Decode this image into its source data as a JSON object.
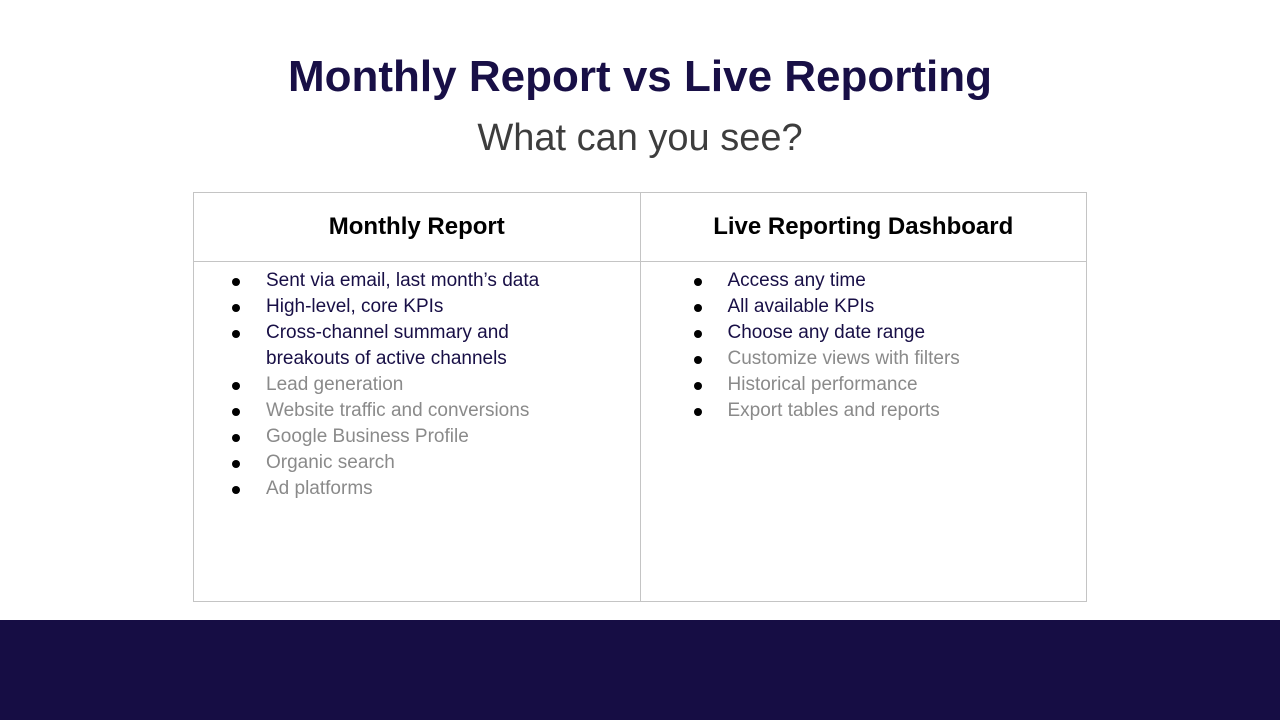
{
  "header": {
    "title": "Monthly Report vs Live Reporting",
    "subtitle": "What can you see?"
  },
  "colors": {
    "title": "#180f46",
    "subtitle": "#3d3d3d",
    "text_primary": "#180f46",
    "text_muted": "#8a8a8a",
    "footer": "#160d44",
    "border": "#c4c4c4"
  },
  "table": {
    "columns": [
      {
        "heading": "Monthly Report",
        "items": [
          {
            "text": "Sent via email, last month’s data",
            "style": "dark"
          },
          {
            "text": "High-level, core KPIs",
            "style": "dark"
          },
          {
            "text": "Cross-channel summary and breakouts of active channels",
            "style": "dark"
          },
          {
            "text": "Lead generation",
            "style": "muted"
          },
          {
            "text": "Website traffic and conversions",
            "style": "muted"
          },
          {
            "text": "Google Business Profile",
            "style": "muted"
          },
          {
            "text": "Organic search",
            "style": "muted"
          },
          {
            "text": "Ad platforms",
            "style": "muted"
          }
        ]
      },
      {
        "heading": "Live Reporting Dashboard",
        "items": [
          {
            "text": "Access any time",
            "style": "dark"
          },
          {
            "text": "All available KPIs",
            "style": "dark"
          },
          {
            "text": "Choose any date range",
            "style": "dark"
          },
          {
            "text": "Customize views with filters",
            "style": "muted"
          },
          {
            "text": "Historical performance",
            "style": "muted"
          },
          {
            "text": "Export tables and reports",
            "style": "muted"
          }
        ]
      }
    ]
  }
}
